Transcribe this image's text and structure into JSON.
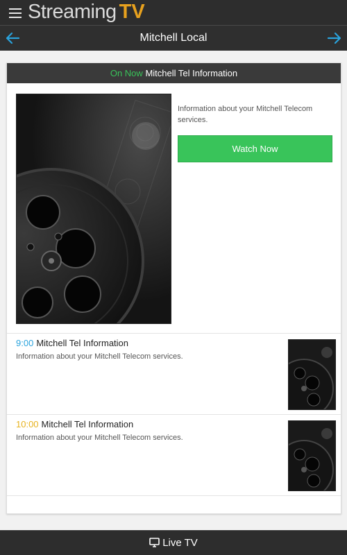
{
  "app": {
    "brand_main": "Streaming",
    "brand_tv": "TV"
  },
  "nav": {
    "title": "Mitchell Local"
  },
  "now_playing": {
    "on_now_label": "On Now",
    "title": "Mitchell Tel Information",
    "description": "Information about your Mitchell Telecom services.",
    "watch_button": "Watch Now"
  },
  "schedule": [
    {
      "time": "9:00",
      "time_color": "#2aa3dd",
      "title": "Mitchell Tel Information",
      "description": "Information about your Mitchell Telecom services."
    },
    {
      "time": "10:00",
      "time_color": "#e7b21e",
      "title": "Mitchell Tel Information",
      "description": "Information about your Mitchell Telecom services."
    }
  ],
  "footer": {
    "label": "Live TV"
  },
  "colors": {
    "accent_green": "#39c45a",
    "brand_orange": "#e7a11e",
    "arrow_blue": "#2aa3dd"
  },
  "icons": [
    "menu-icon",
    "arrow-left-icon",
    "arrow-right-icon",
    "film-reel-icon",
    "tv-icon"
  ]
}
